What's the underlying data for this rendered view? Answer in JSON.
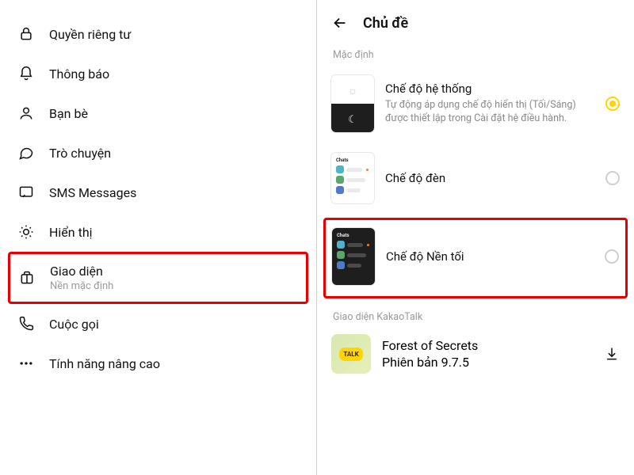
{
  "left": {
    "items": [
      {
        "label": "Quyền riêng tư"
      },
      {
        "label": "Thông báo"
      },
      {
        "label": "Bạn bè"
      },
      {
        "label": "Trò chuyện"
      },
      {
        "label": "SMS Messages"
      },
      {
        "label": "Hiển thị"
      },
      {
        "label": "Giao diện",
        "sub": "Nền mặc định"
      },
      {
        "label": "Cuộc gọi"
      },
      {
        "label": "Tính năng nâng cao"
      }
    ]
  },
  "right": {
    "title": "Chủ đề",
    "section_default": "Mặc định",
    "options": [
      {
        "name": "Chế độ hệ thống",
        "desc": "Tự động áp dụng chế độ hiển thị (Tối/Sáng) được thiết lập trong Cài đặt hệ điều hành.",
        "thumb_label": ""
      },
      {
        "name": "Chế độ đèn",
        "thumb_label": "Chats"
      },
      {
        "name": "Chế độ Nền tối",
        "thumb_label": "Chats"
      }
    ],
    "section_kakao": "Giao diện KakaoTalk",
    "kakao": {
      "name": "Forest of Secrets",
      "version": "Phiên bản 9.7.5",
      "bubble": "TALK"
    }
  }
}
